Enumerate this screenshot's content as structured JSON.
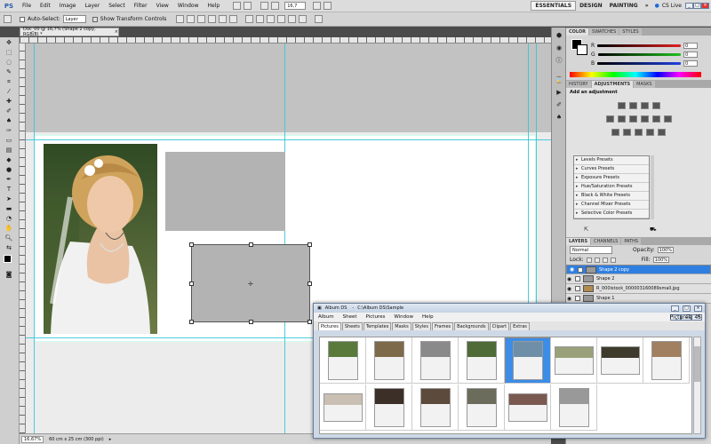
{
  "app": {
    "logo": "PS"
  },
  "menubar": {
    "items": [
      "File",
      "Edit",
      "Image",
      "Layer",
      "Select",
      "Filter",
      "View",
      "Window",
      "Help"
    ],
    "zoom": "16,7",
    "workspaces": [
      "ESSENTIALS",
      "DESIGN",
      "PAINTING"
    ],
    "more": "»",
    "cslive": "CS Live"
  },
  "optbar": {
    "auto_select_label": "Auto-Select:",
    "auto_select_value": "Layer",
    "transform_label": "Show Transform Controls"
  },
  "document": {
    "tab_title": "Doc_00 @ 16,7% (Shape 2 copy, RGB/8) *",
    "status_zoom": "16,67%",
    "status_info": "60 cm x 25 cm (300 ppi)"
  },
  "color_panel": {
    "tabs": [
      "COLOR",
      "SWATCHES",
      "STYLES"
    ],
    "channels": [
      {
        "label": "R",
        "value": "0",
        "color": "#e02020"
      },
      {
        "label": "G",
        "value": "0",
        "color": "#20c020"
      },
      {
        "label": "B",
        "value": "0",
        "color": "#2040e0"
      }
    ]
  },
  "adjust_panel": {
    "tabs": [
      "HISTORY",
      "ADJUSTMENTS",
      "MASKS"
    ],
    "heading": "Add an adjustment",
    "presets": [
      "Levels Presets",
      "Curves Presets",
      "Exposure Presets",
      "Hue/Saturation Presets",
      "Black & White Presets",
      "Channel Mixer Presets",
      "Selective Color Presets"
    ]
  },
  "layers_panel": {
    "tabs": [
      "LAYERS",
      "CHANNELS",
      "PATHS"
    ],
    "blend_mode": "Normal",
    "opacity_label": "Opacity:",
    "opacity_value": "100%",
    "lock_label": "Lock:",
    "fill_label": "Fill:",
    "fill_value": "100%",
    "layers": [
      {
        "name": "Shape 2 copy",
        "selected": true
      },
      {
        "name": "Shape 2",
        "selected": false
      },
      {
        "name": "R_000istock_000003160089small.jpg",
        "selected": false
      },
      {
        "name": "Shape 1",
        "selected": false
      }
    ]
  },
  "album": {
    "title": "Album DS",
    "path": "C:\\Album DS\\Sample",
    "menu": [
      "Album",
      "Sheet",
      "Pictures",
      "Window",
      "Help"
    ],
    "tabs": [
      "Pictures",
      "Sheets",
      "Templates",
      "Masks",
      "Styles",
      "Frames",
      "Backgrounds",
      "Clipart",
      "Extras"
    ],
    "pictures_count": "Pictures: 45",
    "thumbnails": 14,
    "selected_index": 4
  }
}
